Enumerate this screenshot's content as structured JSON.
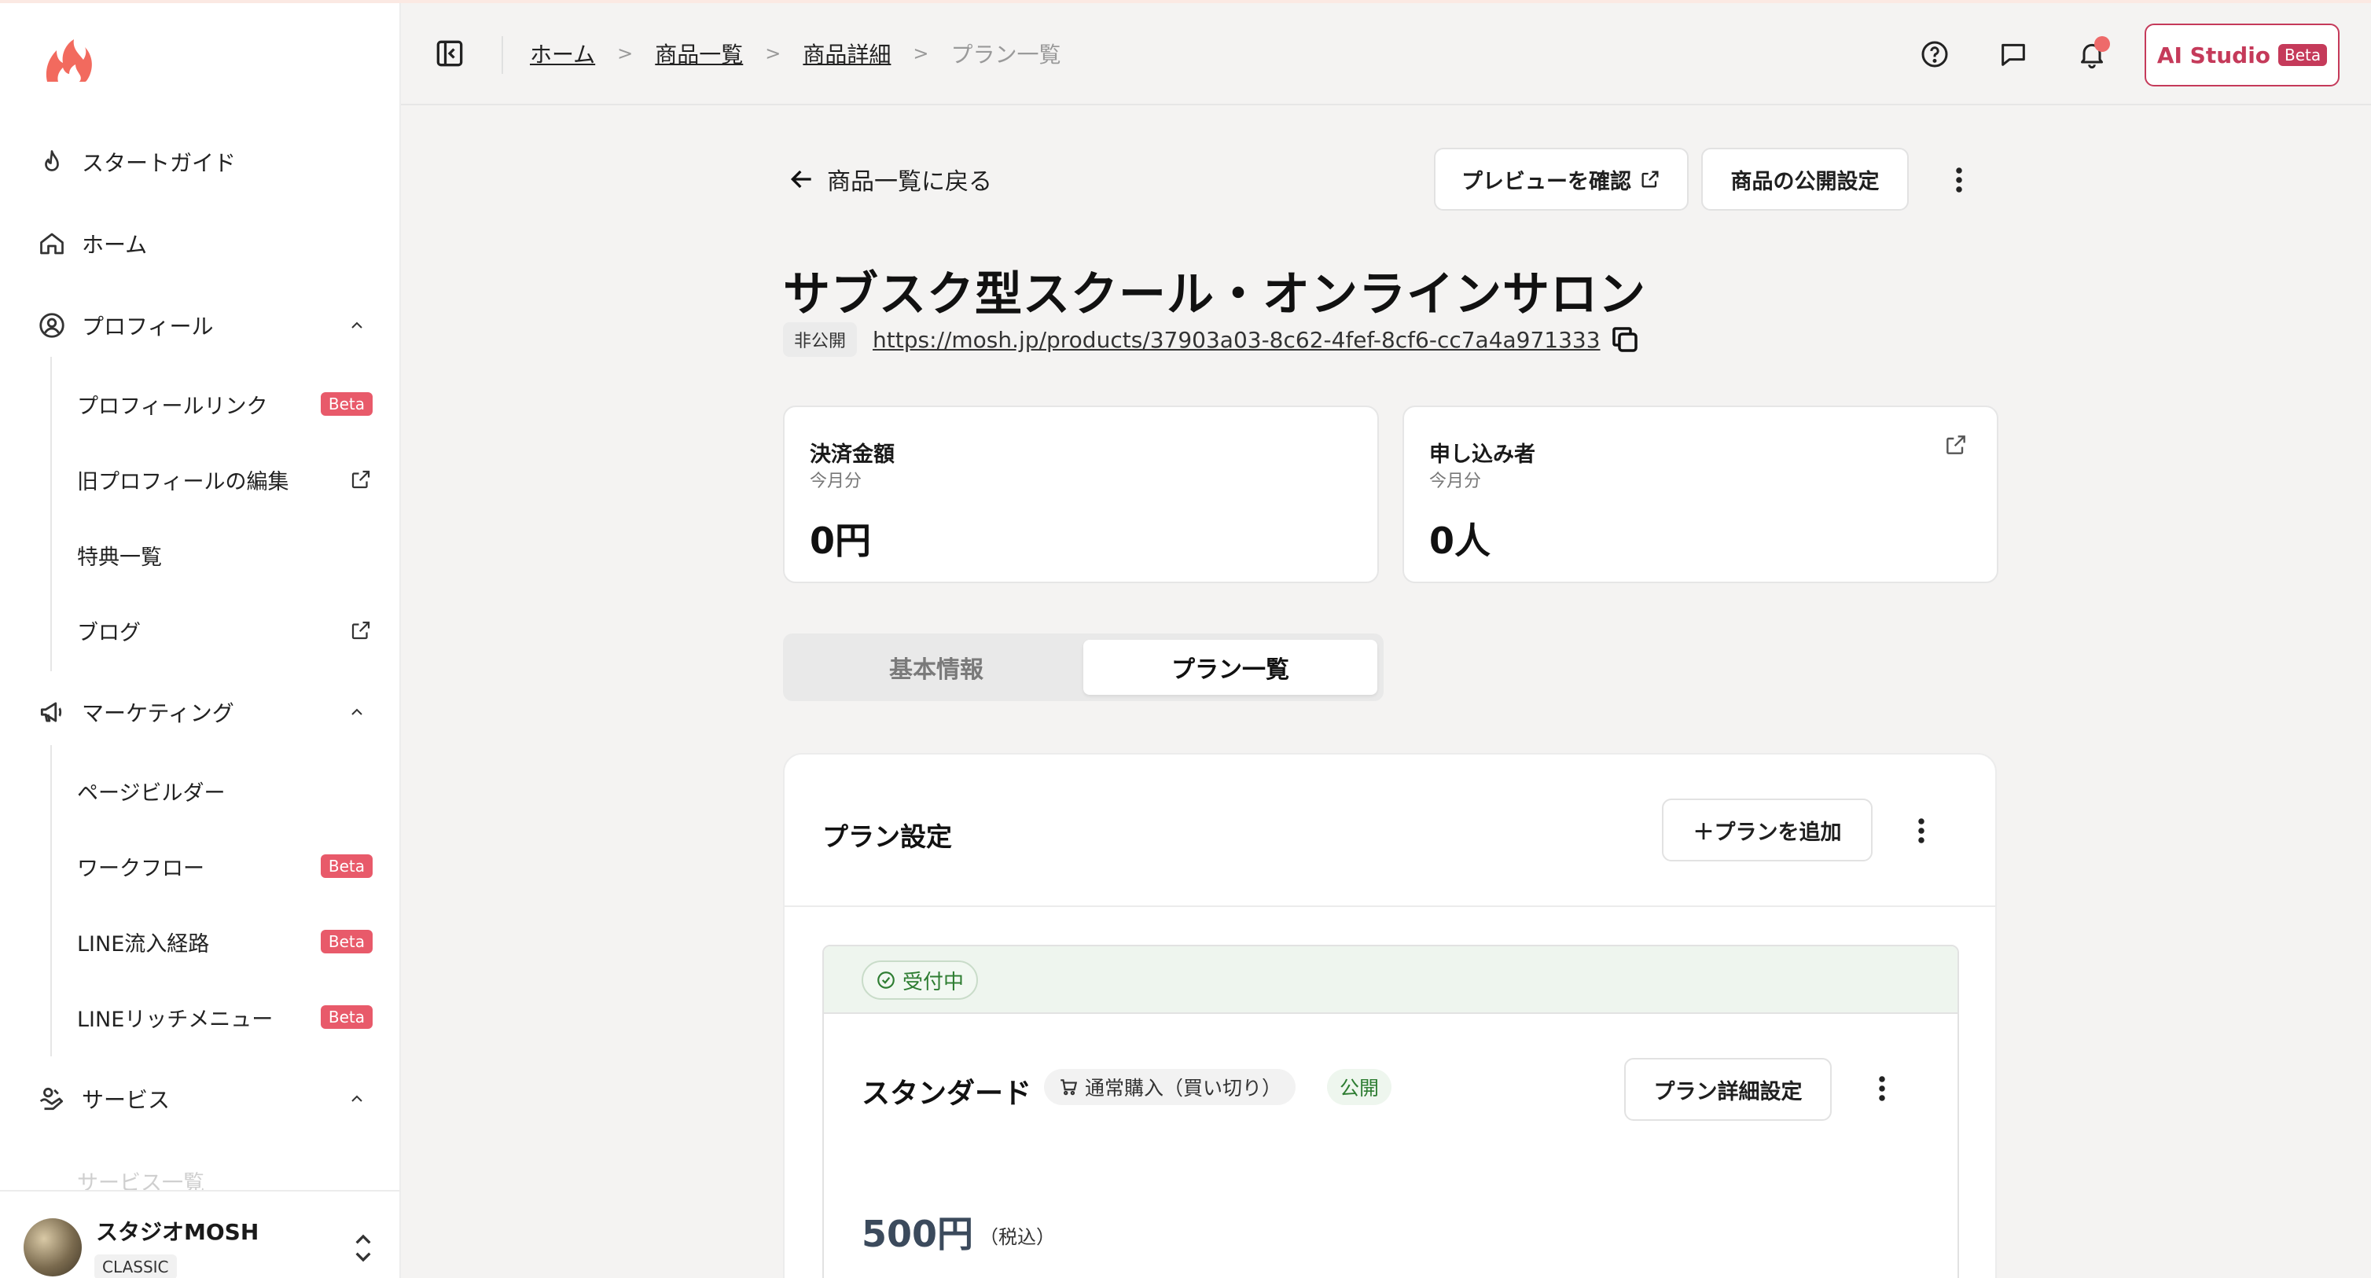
{
  "sidebar": {
    "logo": "mosh-flame-logo",
    "nav": [
      {
        "label": "スタートガイド",
        "icon": "flame-icon"
      },
      {
        "label": "ホーム",
        "icon": "home-icon"
      },
      {
        "label": "プロフィール",
        "icon": "user-circle-icon"
      },
      {
        "label": "マーケティング",
        "icon": "megaphone-icon"
      },
      {
        "label": "サービス",
        "icon": "service-icon"
      }
    ],
    "profile_sub": [
      {
        "label": "プロフィールリンク",
        "badge": "Beta"
      },
      {
        "label": "旧プロフィールの編集",
        "icon": "external-link-icon"
      },
      {
        "label": "特典一覧"
      },
      {
        "label": "ブログ",
        "icon": "external-link-icon"
      }
    ],
    "marketing_sub": [
      {
        "label": "ページビルダー"
      },
      {
        "label": "ワークフロー",
        "badge": "Beta"
      },
      {
        "label": "LINE流入経路",
        "badge": "Beta"
      },
      {
        "label": "LINEリッチメニュー",
        "badge": "Beta"
      }
    ],
    "service_sub": [
      {
        "label": "サービス一覧"
      }
    ],
    "account": {
      "name": "スタジオMOSH",
      "plan": "CLASSIC"
    }
  },
  "header": {
    "breadcrumb": [
      "ホーム",
      "商品一覧",
      "商品詳細"
    ],
    "breadcrumb_current": "プラン一覧",
    "ai_studio": {
      "label": "AI Studio",
      "badge": "Beta"
    },
    "accent": "#c53a5a"
  },
  "main": {
    "back_label": "商品一覧に戻る",
    "preview_button": "プレビューを確認",
    "publish_button": "商品の公開設定",
    "title": "サブスク型スクール・オンラインサロン",
    "visibility": "非公開",
    "url": "https://mosh.jp/products/37903a03-8c62-4fef-8cf6-cc7a4a971333",
    "stats": [
      {
        "label": "決済金額",
        "period": "今月分",
        "value": "0円"
      },
      {
        "label": "申し込み者",
        "period": "今月分",
        "value": "0人"
      }
    ],
    "tabs": [
      {
        "label": "基本情報",
        "active": false
      },
      {
        "label": "プラン一覧",
        "active": true
      }
    ],
    "plan_section": {
      "title": "プラン設定",
      "add_button": "＋プランを追加",
      "plans": [
        {
          "status": "受付中",
          "name": "スタンダード",
          "purchase_type": "通常購入（買い切り）",
          "visibility": "公開",
          "detail_button": "プラン詳細設定",
          "price": "500円",
          "tax_note": "（税込）"
        }
      ]
    }
  }
}
